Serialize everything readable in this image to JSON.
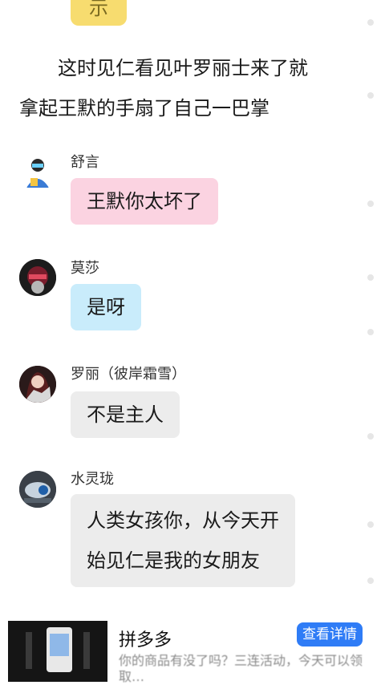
{
  "top_bubble": {
    "text": "示"
  },
  "narration": [
    "　　这时见仁看见叶罗丽士来了就",
    "拿起王默的手扇了自己一巴掌"
  ],
  "messages": [
    {
      "name": "舒言",
      "text": "王默你太坏了",
      "bubble_color": "#fbd3e1"
    },
    {
      "name": "莫莎",
      "text": "是呀",
      "bubble_color": "#c9ecfb"
    },
    {
      "name": "罗丽（彼岸霜雪）",
      "text": "不是主人",
      "bubble_color": "#ececec"
    },
    {
      "name": "水灵珑",
      "lines": [
        "人类女孩你，从今天开",
        "始见仁是我的女朋友"
      ],
      "bubble_color": "#ececec"
    }
  ],
  "ad": {
    "title": "拼多多",
    "button": "查看详情",
    "description": "你的商品有没了吗？三连活动，今天可以领取…"
  },
  "colors": {
    "accent": "#2f7cf6",
    "narration_text": "#1a1a1a"
  }
}
